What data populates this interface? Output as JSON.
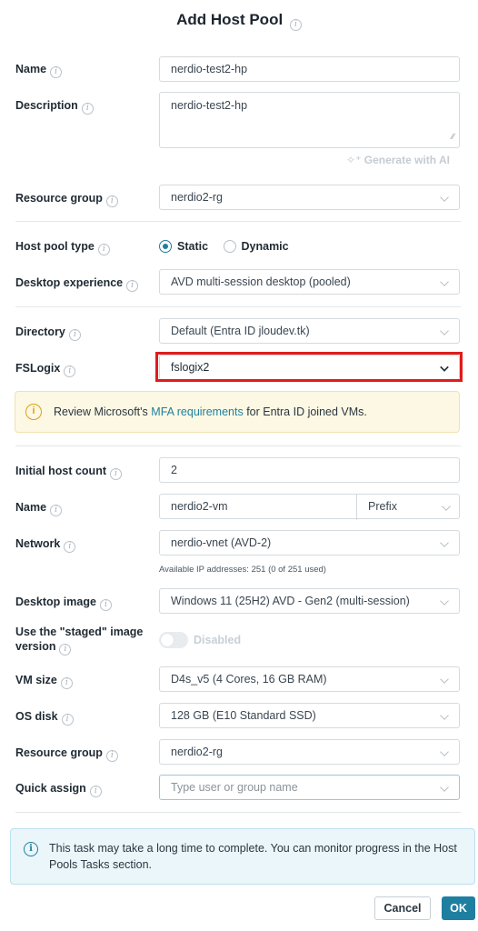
{
  "dialog": {
    "title": "Add Host Pool",
    "name_label": "Name",
    "name_value": "nerdio-test2-hp",
    "description_label": "Description",
    "description_value": "nerdio-test2-hp",
    "generate_ai_label": "Generate with AI",
    "resource_group_label": "Resource group",
    "resource_group_value": "nerdio2-rg",
    "host_pool_type_label": "Host pool type",
    "host_pool_type_options": [
      "Static",
      "Dynamic"
    ],
    "host_pool_type_selected": "Static",
    "desktop_experience_label": "Desktop experience",
    "desktop_experience_value": "AVD multi-session desktop (pooled)",
    "directory_label": "Directory",
    "directory_value": "Default (Entra ID jloudev.tk)",
    "fslogix_label": "FSLogix",
    "fslogix_value": "fslogix2",
    "mfa_notice": {
      "prefix": "Review Microsoft's ",
      "link": "MFA requirements",
      "suffix": " for Entra ID joined VMs."
    },
    "initial_host_count_label": "Initial host count",
    "initial_host_count_value": "2",
    "vm_name_label": "Name",
    "vm_name_value": "nerdio2-vm",
    "vm_name_mode": "Prefix",
    "network_label": "Network",
    "network_value": "nerdio-vnet (AVD-2)",
    "ip_note": "Available IP addresses: 251 (0 of 251 used)",
    "desktop_image_label": "Desktop image",
    "desktop_image_value": "Windows 11 (25H2) AVD - Gen2 (multi-session)",
    "staged_image_label_line1": "Use the \"staged\" image",
    "staged_image_label_line2": "version",
    "staged_toggle_label": "Disabled",
    "vm_size_label": "VM size",
    "vm_size_value": "D4s_v5 (4 Cores, 16 GB RAM)",
    "os_disk_label": "OS disk",
    "os_disk_value": "128 GB (E10 Standard SSD)",
    "resource_group2_label": "Resource group",
    "resource_group2_value": "nerdio2-rg",
    "quick_assign_label": "Quick assign",
    "quick_assign_placeholder": "Type user or group name",
    "task_notice": "This task may take a long time to complete. You can monitor progress in the Host Pools Tasks section.",
    "cancel_label": "Cancel",
    "ok_label": "OK"
  },
  "colors": {
    "accent": "#1f7fa0",
    "highlight": "#e01b1b",
    "warning": "#d9a212"
  }
}
